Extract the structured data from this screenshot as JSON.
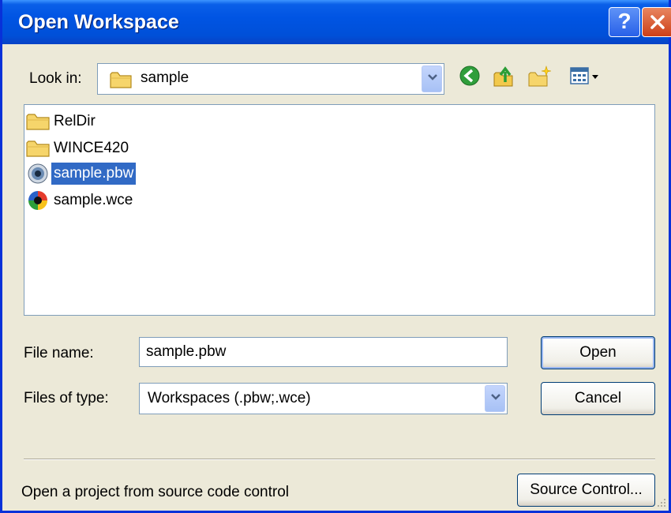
{
  "window": {
    "title": "Open Workspace",
    "help_label": "?"
  },
  "look_in": {
    "label": "Look in:",
    "value": "sample"
  },
  "toolbar": {
    "back": "back-icon",
    "up": "up-folder-icon",
    "new_folder": "new-folder-icon",
    "view_menu": "view-menu-icon"
  },
  "files": [
    {
      "name": "RelDir",
      "icon": "folder-icon"
    },
    {
      "name": "WINCE420",
      "icon": "folder-icon"
    },
    {
      "name": "sample.pbw",
      "icon": "workspace-pbw-icon",
      "selected": true
    },
    {
      "name": "sample.wce",
      "icon": "workspace-wce-icon"
    }
  ],
  "file_name": {
    "label": "File name:",
    "value": "sample.pbw"
  },
  "file_type": {
    "label": "Files of type:",
    "value": "Workspaces (.pbw;.wce)"
  },
  "buttons": {
    "open": "Open",
    "cancel": "Cancel",
    "source_control": "Source Control..."
  },
  "footer": {
    "text": "Open a project from source code control"
  },
  "colors": {
    "titlebar": "#0054e3",
    "selection": "#316ac5",
    "dialog_bg": "#ece9d8"
  }
}
